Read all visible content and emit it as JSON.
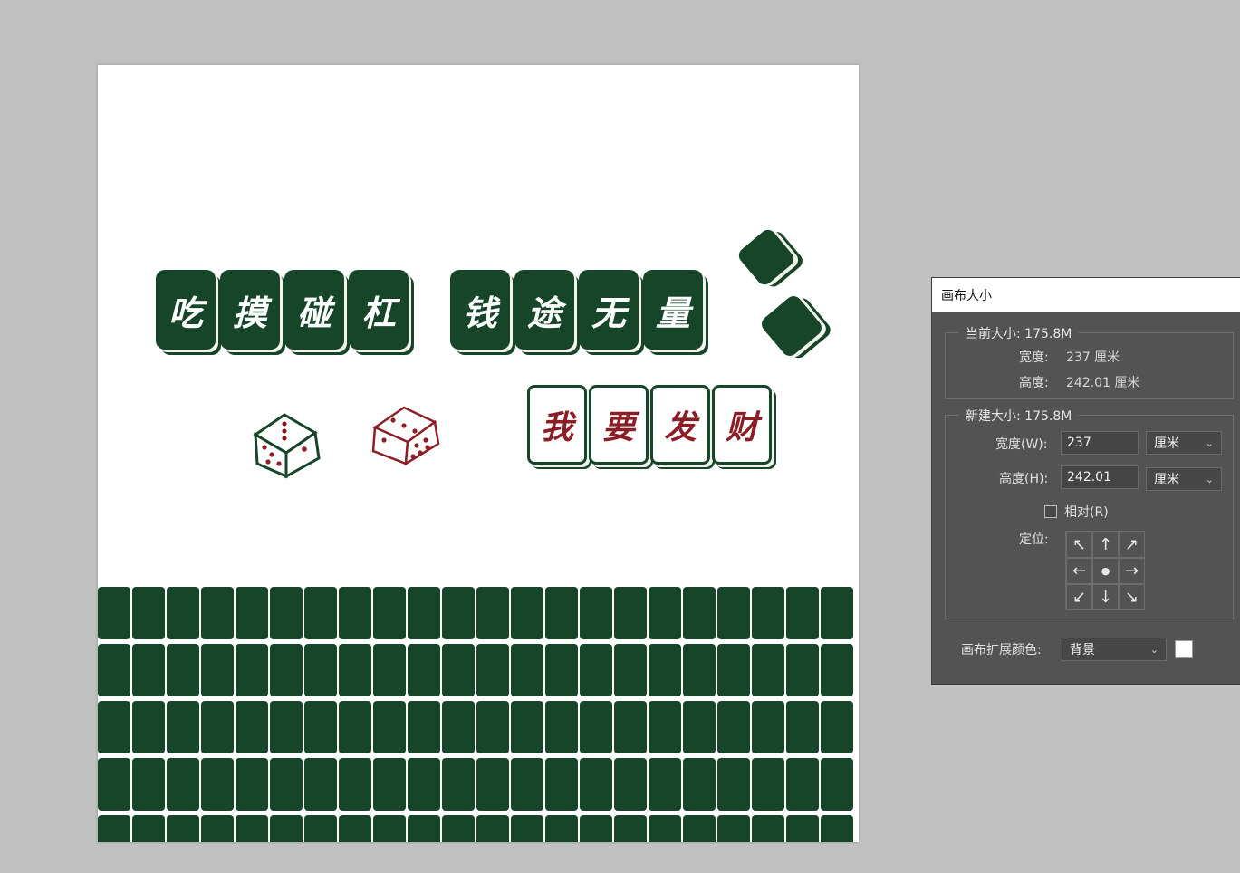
{
  "canvas": {
    "top_tiles_group1": [
      "吃",
      "摸",
      "碰",
      "杠"
    ],
    "top_tiles_group2": [
      "钱",
      "途",
      "无",
      "量"
    ],
    "red_tiles": [
      "我",
      "要",
      "发",
      "财"
    ],
    "colors": {
      "tile_green": "#17452a",
      "tile_red_text": "#8c1f26",
      "background": "#ffffff"
    }
  },
  "dialog": {
    "title": "画布大小",
    "current_size": {
      "title": "当前大小: 175.8M",
      "width_label": "宽度:",
      "width_value": "237 厘米",
      "height_label": "高度:",
      "height_value": "242.01 厘米"
    },
    "new_size": {
      "title": "新建大小: 175.8M",
      "width_label": "宽度(W):",
      "width_value": "237",
      "width_unit": "厘米",
      "height_label": "高度(H):",
      "height_value": "242.01",
      "height_unit": "厘米",
      "relative_label": "相对(R)",
      "relative_checked": false,
      "anchor_label": "定位:",
      "anchor_arrows": [
        "↖",
        "↑",
        "↗",
        "←",
        "●",
        "→",
        "↙",
        "↓",
        "↘"
      ]
    },
    "extension_color_label": "画布扩展颜色:",
    "extension_color_value": "背景",
    "swatch_color": "#ffffff"
  }
}
